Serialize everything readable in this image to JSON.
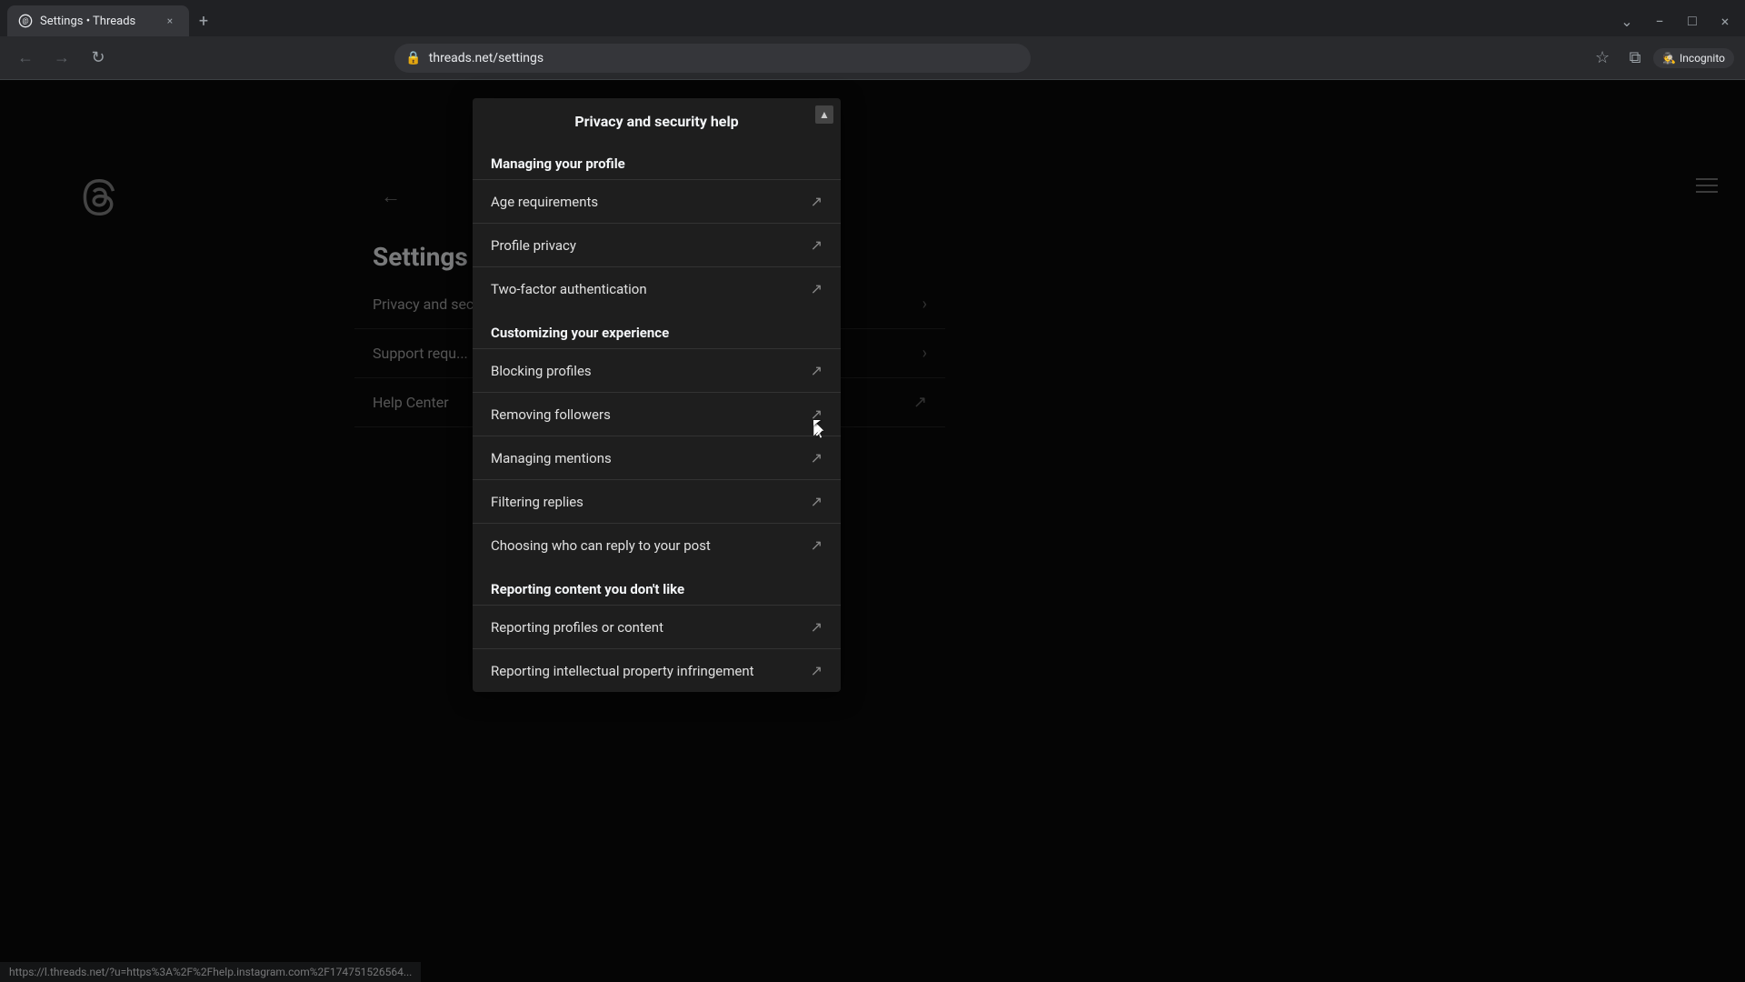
{
  "browser": {
    "tab_title": "Settings • Threads",
    "tab_favicon": "⊙",
    "url": "threads.net/settings",
    "new_tab_icon": "+",
    "back_icon": "←",
    "forward_icon": "→",
    "reload_icon": "↻",
    "star_icon": "☆",
    "incognito_label": "Incognito",
    "minimize_icon": "−",
    "maximize_icon": "□",
    "close_icon": "×",
    "tab_list_icon": "⌄"
  },
  "page": {
    "settings_title": "Settings",
    "back_arrow": "←",
    "menu_items": [
      {
        "label": "Privacy and sec..."
      },
      {
        "label": "Support requ..."
      },
      {
        "label": "Help Center"
      }
    ]
  },
  "help_panel": {
    "title": "Privacy and security help",
    "sections": [
      {
        "heading": "Managing your profile",
        "items": [
          {
            "label": "Age requirements",
            "external": true
          },
          {
            "label": "Profile privacy",
            "external": true
          },
          {
            "label": "Two-factor authentication",
            "external": true
          }
        ]
      },
      {
        "heading": "Customizing your experience",
        "items": [
          {
            "label": "Blocking profiles",
            "external": true
          },
          {
            "label": "Removing followers",
            "external": true
          },
          {
            "label": "Managing mentions",
            "external": true
          },
          {
            "label": "Filtering replies",
            "external": true
          },
          {
            "label": "Choosing who can reply to your post",
            "external": true
          }
        ]
      },
      {
        "heading": "Reporting content you don't like",
        "items": [
          {
            "label": "Reporting profiles or content",
            "external": true
          },
          {
            "label": "Reporting intellectual property infringement",
            "external": true
          }
        ]
      }
    ]
  },
  "status_bar": {
    "url": "https://l.threads.net/?u=https%3A%2F%2Fhelp.instagram.com%2F174751526564..."
  }
}
